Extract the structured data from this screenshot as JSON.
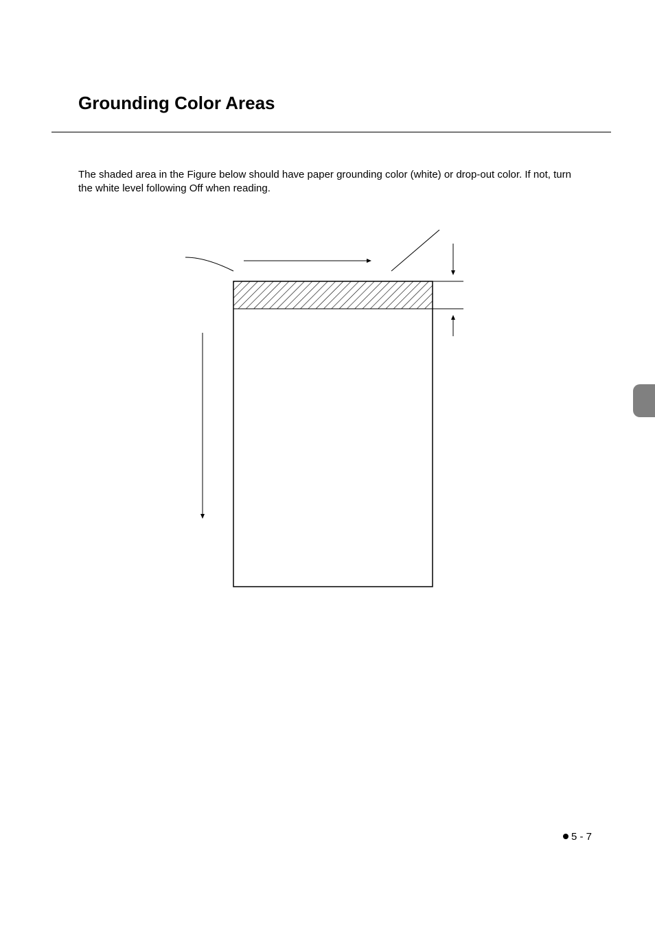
{
  "title": "Grounding Color Areas",
  "body": "The shaded area in the Figure below should have paper grounding color (white) or drop-out color. If not, turn the white level following Off when reading.",
  "page_number": "5 - 7",
  "chart_data": {
    "type": "diagram",
    "description": "Technical diagram showing a rectangular document/page shape with a hatched (shaded) horizontal band near the top edge. Arrows indicate: feed direction (downward on left side), main scanning width (horizontal arrow pointing right across top), a diagonal pointer line from upper right, and vertical dimension arrows on right side indicating the height of the shaded band.",
    "elements": {
      "main_rectangle": "tall portrait rectangle representing a document",
      "shaded_band": "diagonal-hatched band across full width near top of rectangle",
      "arrows": [
        "left vertical arrow pointing down (feed/sub-scan direction)",
        "top horizontal arrow pointing right (main scan direction)",
        "diagonal line from upper-right pointing into top area",
        "curved pointer line from upper-left",
        "right side dimension arrows bracketing shaded band height"
      ]
    }
  }
}
